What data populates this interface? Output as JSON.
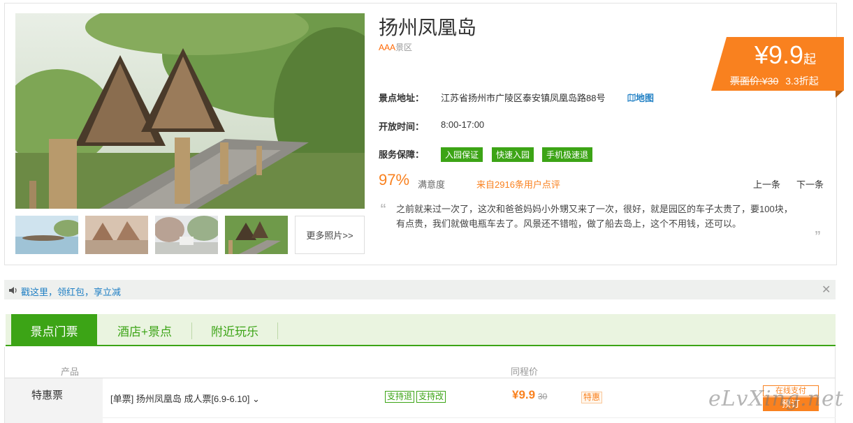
{
  "attraction": {
    "title": "扬州凤凰岛",
    "grade_aaa": "AAA",
    "grade_suffix": "景区",
    "address_label": "景点地址：",
    "address": "江苏省扬州市广陵区泰安镇凤凰岛路88号",
    "map_link": "地图",
    "hours_label": "开放时间：",
    "hours": "8:00-17:00",
    "service_label": "服务保障：",
    "service_tags": [
      "入园保证",
      "快速入园",
      "手机极速退"
    ]
  },
  "price": {
    "amount": "¥9.9",
    "suffix": "起",
    "original": "票面价:¥30",
    "discount": "3.3折起"
  },
  "gallery": {
    "more_label": "更多照片>>",
    "thumbnails": [
      "thumb-lake-boat",
      "thumb-pavilion",
      "thumb-trees",
      "thumb-boardwalk"
    ]
  },
  "review": {
    "satisfaction": "97%",
    "satisfaction_label": "满意度",
    "source": "来自2916条用户点评",
    "prev": "上一条",
    "next": "下一条",
    "quote": "之前就来过一次了，这次和爸爸妈妈小外甥又来了一次，很好，就是园区的车子太贵了，要100块，有点贵，我们就做电瓶车去了。风景还不错啦，做了船去岛上，这个不用钱，还可以。"
  },
  "notice": {
    "text": "戳这里，领红包，享立减"
  },
  "tabs": [
    {
      "label": "景点门票",
      "active": true
    },
    {
      "label": "酒店+景点",
      "active": false
    },
    {
      "label": "附近玩乐",
      "active": false
    }
  ],
  "table": {
    "col_product": "产品",
    "col_price": "同程价",
    "rows": [
      {
        "category": "特惠票",
        "product": "[单票] 扬州凤凰岛 成人票[6.9-6.10] ⌄",
        "tags": [
          "支持退",
          "支持改"
        ],
        "price": "¥9.9",
        "original": "30",
        "badge": "特惠",
        "pay_label": "在线支付",
        "book_label": "预订"
      }
    ]
  },
  "watermark": "eLvXing.net",
  "colors": {
    "accent_orange": "#f9811f",
    "accent_green": "#3ca416",
    "link_blue": "#1f7fc4"
  },
  "icons": {
    "speaker": "speaker-icon",
    "close": "close-icon",
    "map": "map-icon",
    "quote_open": "quote-open-icon",
    "quote_close": "quote-close-icon"
  }
}
